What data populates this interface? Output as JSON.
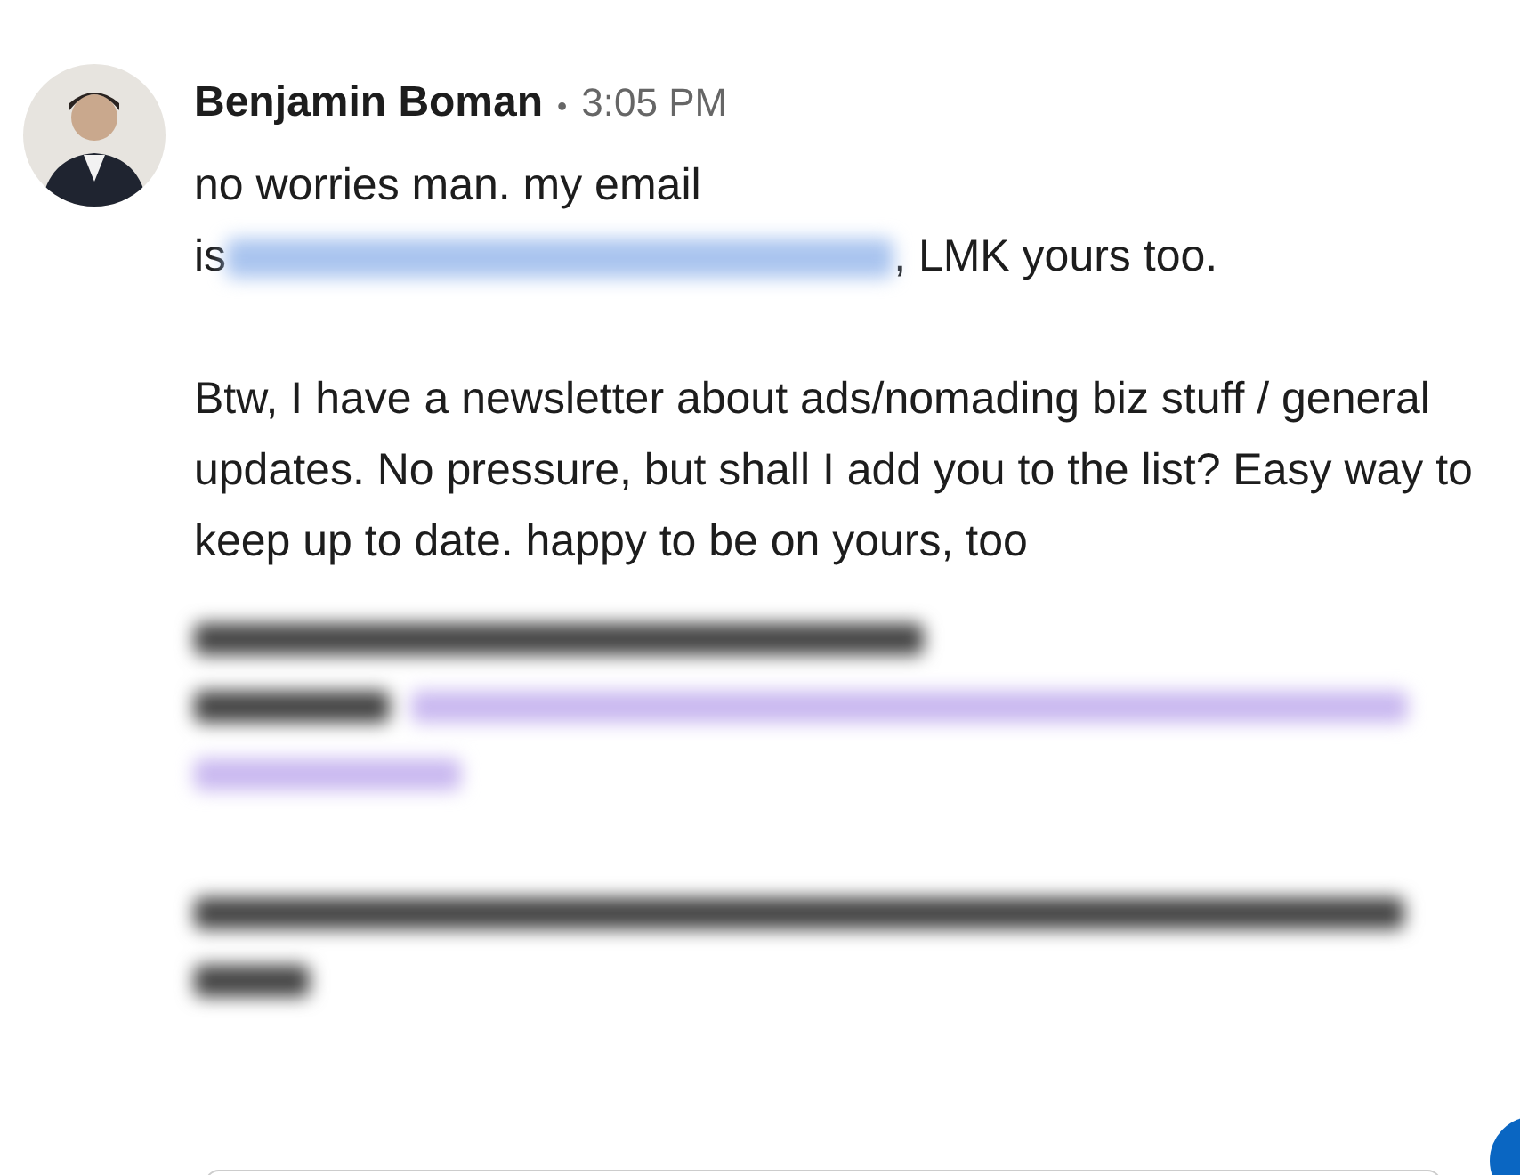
{
  "message": {
    "sender": "Benjamin Boman",
    "separator": "•",
    "time": "3:05 PM",
    "email_line": {
      "before": "no worries man. my email ",
      "is": "is",
      "after": ", LMK yours too."
    },
    "paragraph": "Btw, I have a newsletter about ads/nomading biz stuff / general updates. No pressure, but shall I add you to the list? Easy way to keep up to date. happy to be on yours, too"
  }
}
